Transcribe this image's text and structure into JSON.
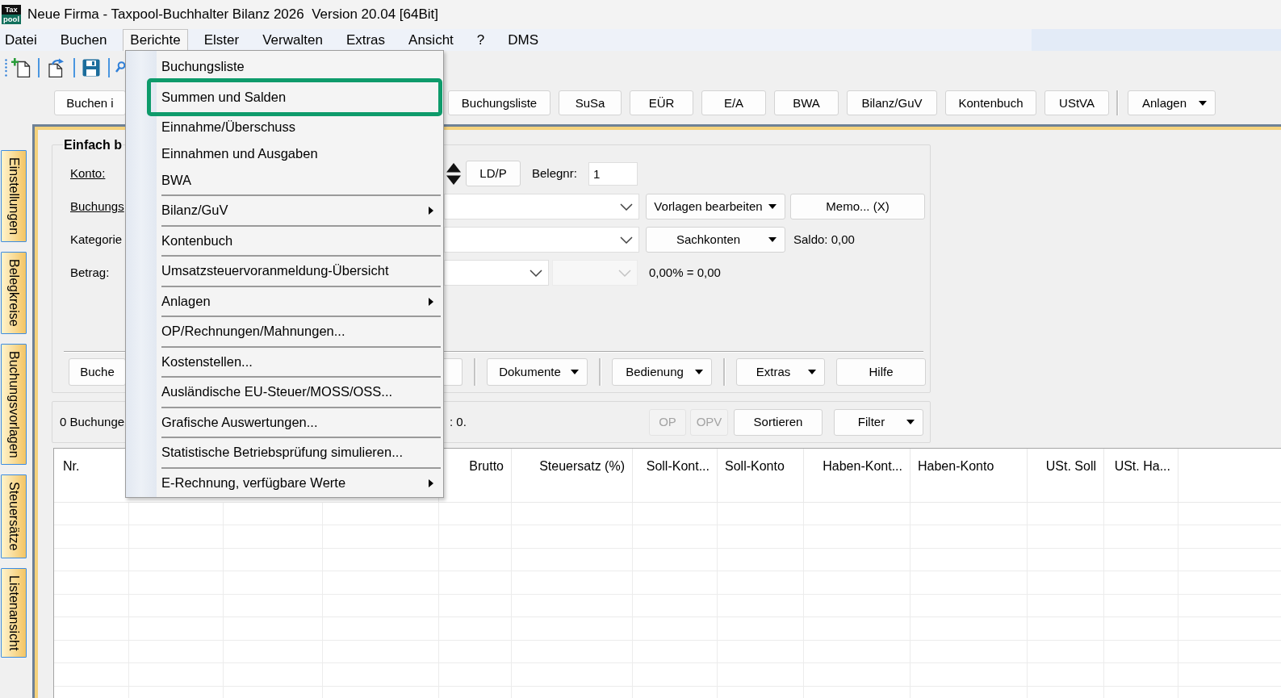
{
  "window": {
    "logo": {
      "line_1": "Tax",
      "line_2": "pool"
    },
    "title": "Neue Firma - Taxpool-Buchhalter Bilanz 2026  Version 20.04 [64Bit]"
  },
  "menu_bar": [
    {
      "label": "Datei",
      "selected": false
    },
    {
      "label": "Buchen",
      "selected": false
    },
    {
      "label": "Berichte",
      "selected": true
    },
    {
      "label": "Elster",
      "selected": false
    },
    {
      "label": "Verwalten",
      "selected": false
    },
    {
      "label": "Extras",
      "selected": false
    },
    {
      "label": "Ansicht",
      "selected": false
    },
    {
      "label": "?",
      "selected": false
    },
    {
      "label": "DMS",
      "selected": false
    }
  ],
  "reports_menu": {
    "items": [
      {
        "kind": "item",
        "label": "Buchungsliste",
        "submenu": false,
        "highlighted": false
      },
      {
        "kind": "item",
        "label": "Summen und Salden",
        "submenu": false,
        "highlighted": true
      },
      {
        "kind": "item",
        "label": "Einnahme/Überschuss",
        "submenu": false,
        "highlighted": false
      },
      {
        "kind": "item",
        "label": "Einnahmen und Ausgaben",
        "submenu": false,
        "highlighted": false
      },
      {
        "kind": "item",
        "label": "BWA",
        "submenu": false,
        "highlighted": false
      },
      {
        "kind": "separator"
      },
      {
        "kind": "item",
        "label": "Bilanz/GuV",
        "submenu": true,
        "highlighted": false
      },
      {
        "kind": "separator"
      },
      {
        "kind": "item",
        "label": "Kontenbuch",
        "submenu": false,
        "highlighted": false
      },
      {
        "kind": "separator"
      },
      {
        "kind": "item",
        "label": "Umsatzsteuervoranmeldung-Übersicht",
        "submenu": false,
        "highlighted": false
      },
      {
        "kind": "separator"
      },
      {
        "kind": "item",
        "label": "Anlagen",
        "submenu": true,
        "highlighted": false
      },
      {
        "kind": "separator"
      },
      {
        "kind": "item",
        "label": "OP/Rechnungen/Mahnungen...",
        "submenu": false,
        "highlighted": false
      },
      {
        "kind": "separator"
      },
      {
        "kind": "item",
        "label": "Kostenstellen...",
        "submenu": false,
        "highlighted": false
      },
      {
        "kind": "separator"
      },
      {
        "kind": "item",
        "label": "Ausländische EU-Steuer/MOSS/OSS...",
        "submenu": false,
        "highlighted": false
      },
      {
        "kind": "separator"
      },
      {
        "kind": "item",
        "label": "Grafische Auswertungen...",
        "submenu": false,
        "highlighted": false
      },
      {
        "kind": "separator"
      },
      {
        "kind": "item",
        "label": "Statistische Betriebsprüfung simulieren...",
        "submenu": false,
        "highlighted": false
      },
      {
        "kind": "separator"
      },
      {
        "kind": "item",
        "label": "E-Rechnung, verfügbare Werte",
        "submenu": true,
        "highlighted": false
      }
    ]
  },
  "report_buttons": [
    {
      "label": "Buchen i",
      "dropdown": false,
      "separator_before": false
    },
    {
      "label": "Buchungsliste",
      "dropdown": false,
      "separator_before": false
    },
    {
      "label": "SuSa",
      "dropdown": false,
      "separator_before": false
    },
    {
      "label": "EÜR",
      "dropdown": false,
      "separator_before": false
    },
    {
      "label": "E/A",
      "dropdown": false,
      "separator_before": false
    },
    {
      "label": "BWA",
      "dropdown": false,
      "separator_before": false
    },
    {
      "label": "Bilanz/GuV",
      "dropdown": false,
      "separator_before": false
    },
    {
      "label": "Kontenbuch",
      "dropdown": false,
      "separator_before": false
    },
    {
      "label": "UStVA",
      "dropdown": false,
      "separator_before": false
    },
    {
      "label": "Anlagen",
      "dropdown": true,
      "separator_before": true
    }
  ],
  "side_tabs": [
    "Einstellungen",
    "Belegkreise",
    "Buchungsvorlagen",
    "Steuersätze",
    "Listenansicht"
  ],
  "booking_form": {
    "title": "Einfach b",
    "rows": [
      {
        "label": "Konto:",
        "underlined": true,
        "controls": [
          {
            "kind": "spinner"
          },
          {
            "kind": "button",
            "label": "LD/P",
            "dropdown": false
          },
          {
            "kind": "text",
            "text": "Belegnr:"
          },
          {
            "kind": "input",
            "value": "1"
          }
        ]
      },
      {
        "label": "Buchungs",
        "underlined": true,
        "controls": [
          {
            "kind": "combobox",
            "disabled": false
          },
          {
            "kind": "button",
            "label": "Vorlagen bearbeiten",
            "dropdown": true
          },
          {
            "kind": "button",
            "label": "Memo... (X)",
            "dropdown": false
          }
        ]
      },
      {
        "label": "Kategorie",
        "underlined": false,
        "controls": [
          {
            "kind": "combobox",
            "disabled": false
          },
          {
            "kind": "button",
            "label": "Sachkonten",
            "dropdown": true
          },
          {
            "kind": "text",
            "text": "Saldo: 0,00"
          }
        ]
      },
      {
        "label": "Betrag:",
        "underlined": false,
        "controls": [
          {
            "kind": "combobox",
            "disabled": false
          },
          {
            "kind": "combobox",
            "disabled": true
          },
          {
            "kind": "text",
            "text": "0,00% = 0,00"
          }
        ]
      }
    ],
    "buttons": [
      {
        "label": "Buche",
        "dropdown": false,
        "separator_before": false
      },
      {
        "label": "Dokumente",
        "dropdown": true,
        "separator_before": true
      },
      {
        "label": "Bedienung",
        "dropdown": true,
        "separator_before": true
      },
      {
        "label": "Extras",
        "dropdown": true,
        "separator_before": true
      },
      {
        "label": "Hilfe",
        "dropdown": false,
        "separator_before": false
      }
    ]
  },
  "status_bar": {
    "count": "0 Buchunge",
    "summary": ": 0.",
    "buttons": [
      {
        "label": "OP",
        "disabled": true,
        "dropdown": false
      },
      {
        "label": "OPV",
        "disabled": true,
        "dropdown": false
      },
      {
        "label": "Sortieren",
        "disabled": false,
        "dropdown": false
      },
      {
        "label": "Filter",
        "disabled": false,
        "dropdown": true
      }
    ]
  },
  "table": {
    "columns": [
      "Nr.",
      "Brutto",
      "Steuersatz (%)",
      "Soll-Kont...",
      "Soll-Konto",
      "Haben-Kont...",
      "Haben-Konto",
      "USt. Soll",
      "USt. Ha..."
    ]
  }
}
